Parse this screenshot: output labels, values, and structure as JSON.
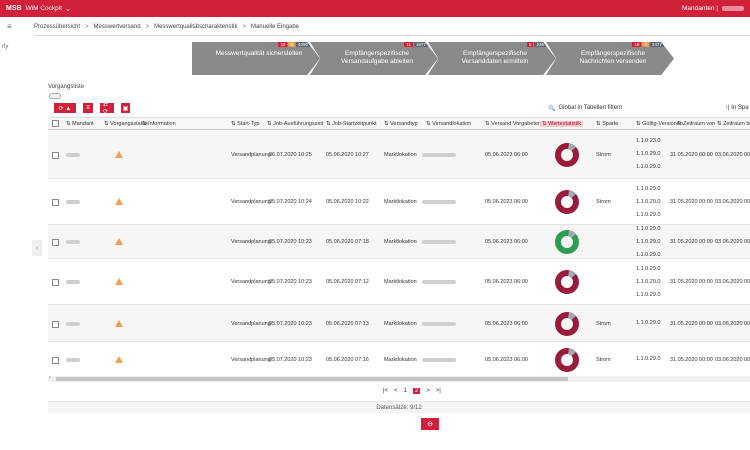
{
  "topbar": {
    "app": "MSB",
    "app_sub": "WiM Cockpit",
    "chevron": "chevron-down-icon",
    "user": "Mandanten |"
  },
  "breadcrumb": [
    "Prozessübersicht",
    "Messwertversand",
    "Messwertqualitätscharakteristik",
    "Manuelle Eingabe"
  ],
  "side": {
    "menu_icon": "menu-icon",
    "label": "rly"
  },
  "steps": [
    {
      "label": "Messwertqualität sicherstellen",
      "badges": [
        "18",
        "0",
        "4290"
      ]
    },
    {
      "label": "Empfängerspezifische Versandaufgabe ableiten",
      "badges": [
        "11",
        "1677"
      ]
    },
    {
      "label": "Empfängerspezifische Versanddaten ermitteln",
      "badges": [
        "5",
        "236"
      ]
    },
    {
      "label": "Empfängerspezifische Nachrichten versenden",
      "badges": [
        "18",
        "0",
        "2477"
      ]
    }
  ],
  "section_title": "Vorgangsliste",
  "toolbar": [
    {
      "icon": "refresh-icon",
      "label": "⟳ ▲"
    },
    {
      "icon": "filter-icon",
      "label": "≡"
    },
    {
      "icon": "export-icon",
      "label": "⇄ ⟳"
    },
    {
      "icon": "delete-icon",
      "label": "▣"
    }
  ],
  "search": {
    "icon": "search-icon",
    "label": "Global in Tabellen filtern"
  },
  "search2": "↑| In Spa",
  "columns": [
    "Mandant",
    "Vorgangsstatus",
    "Information",
    "Start-Typ",
    "Job-Ausführungszeit",
    "Job-Startzeitpunkt",
    "Versandtyp",
    "Versandlokation",
    "Versand Vorgabetermin",
    "Wertestatistik",
    "Sparte",
    "Gültig-Versionen",
    "Zeitraum von",
    "Zeitraum bis"
  ],
  "rows": [
    {
      "start_typ": "Versandplanung",
      "job_exec": "06.07.2020 10:25",
      "job_start": "05.06.2020 10:27",
      "versandtyp": "Marktlokation",
      "vorgabe": "05.06.2023 06:00",
      "donut": "red",
      "sparte": "Strom",
      "versions": [
        "1.1.0.23.0",
        "1.1.0.29.0",
        "1.1.0.29.0"
      ],
      "von": "31.05.2020 00:00",
      "bis": "03.06.2020 00:00"
    },
    {
      "start_typ": "Versandplanung",
      "job_exec": "05.07.2020 10:24",
      "job_start": "05.06.2020 10:22",
      "versandtyp": "Marktlokation",
      "vorgabe": "05.06.2023 06:00",
      "donut": "red",
      "sparte": "Strom",
      "versions": [
        "1.1.0.29.0",
        "1.1.0.29.0",
        "1.1.0.29.0"
      ],
      "von": "31.05.2020 00:00",
      "bis": "03.06.2020 00:00"
    },
    {
      "start_typ": "Versandplanung",
      "job_exec": "05.07.2020 10:23",
      "job_start": "05.06.2020 07:18",
      "versandtyp": "Marktlokation",
      "vorgabe": "05.06.2023 06:00",
      "donut": "green",
      "sparte": "Strom",
      "versions": [
        "1.1.0.29.0",
        "1.1.0.29.0",
        "1.1.0.29.0"
      ],
      "von": "31.05.2020 00:00",
      "bis": "03.06.2020 00:00"
    },
    {
      "start_typ": "Versandplanung",
      "job_exec": "05.07.2020 10:23",
      "job_start": "05.06.2020 07:12",
      "versandtyp": "Marktlokation",
      "vorgabe": "05.06.2023 06:00",
      "donut": "red",
      "sparte": "Strom",
      "versions": [
        "1.1.0.29.0",
        "1.1.0.29.0",
        "1.1.0.29.0"
      ],
      "von": "31.05.2020 00:00",
      "bis": "03.06.2020 00:00"
    },
    {
      "start_typ": "Versandplanung",
      "job_exec": "05.07.2020 10:23",
      "job_start": "05.06.2020 07:13",
      "versandtyp": "Marktlokation",
      "vorgabe": "05.06.2023 06:00",
      "donut": "red",
      "sparte": "Strom",
      "versions": [
        "1.1.0.29.0"
      ],
      "von": "31.05.2020 00:00",
      "bis": "03.06.2020 00:00"
    },
    {
      "start_typ": "Versandplanung",
      "job_exec": "05.07.2020 10:23",
      "job_start": "05.06.2020 07:16",
      "versandtyp": "Marktlokation",
      "vorgabe": "05.06.2023 06:00",
      "donut": "red",
      "sparte": "Strom",
      "versions": [
        "1.1.0.29.0"
      ],
      "von": "31.05.2020 00:00",
      "bis": "03.06.2020 00:00"
    }
  ],
  "pager": [
    "|<",
    "<",
    "1",
    "2",
    ">",
    ">|"
  ],
  "pager_current": "2",
  "footer_info": "Datensätze: 9/12",
  "bottom_button": "⊖",
  "colors": {
    "brand": "#d0203a",
    "donut_red": "#9b1b3a",
    "donut_green": "#2e9d53",
    "donut_grey": "#a0a8b0"
  }
}
